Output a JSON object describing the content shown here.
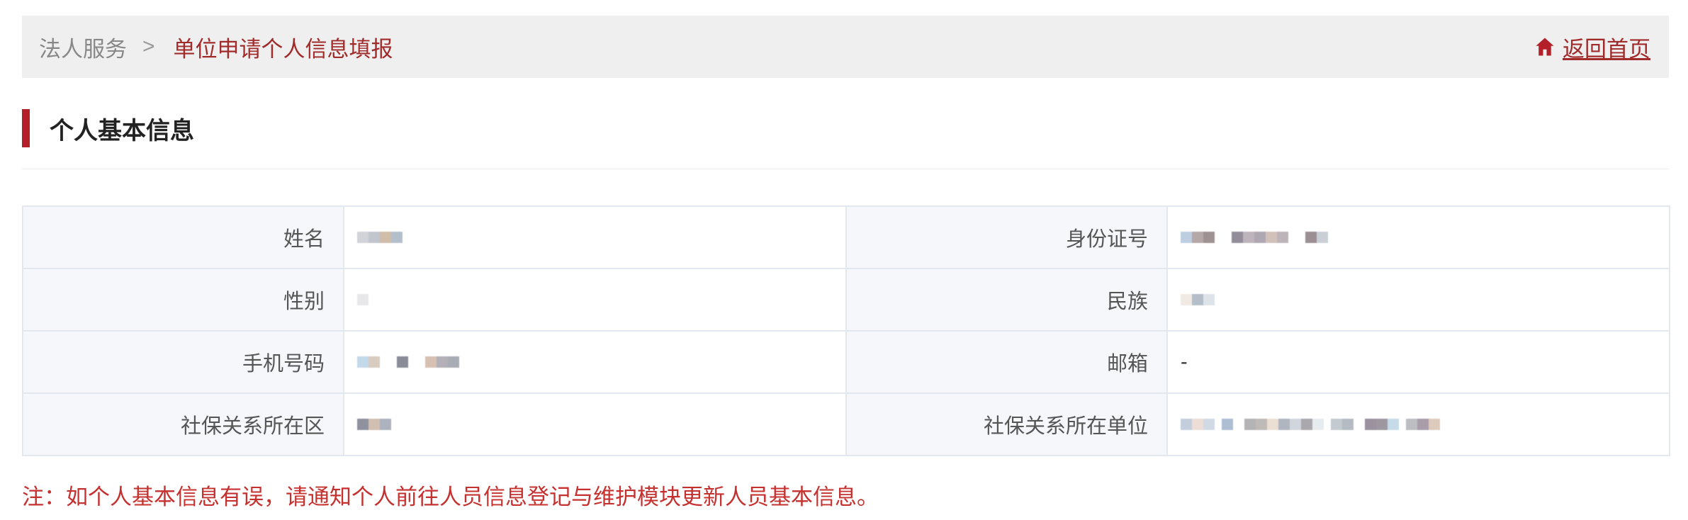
{
  "breadcrumb": {
    "parent": "法人服务",
    "separator": ">",
    "current": "单位申请个人信息填报",
    "home_label": "返回首页",
    "home_icon": "home-icon"
  },
  "section": {
    "title": "个人基本信息"
  },
  "rows": [
    {
      "left_label": "姓名",
      "left_value": "",
      "right_label": "身份证号",
      "right_value": ""
    },
    {
      "left_label": "性别",
      "left_value": "",
      "right_label": "民族",
      "right_value": ""
    },
    {
      "left_label": "手机号码",
      "left_value": "",
      "right_label": "邮箱",
      "right_value": "-"
    },
    {
      "left_label": "社保关系所在区",
      "left_value": "",
      "right_label": "社保关系所在单位",
      "right_value": ""
    }
  ],
  "note": "注：如个人基本信息有误，请通知个人前往人员信息登记与维护模块更新人员基本信息。",
  "colors": {
    "accent": "#b3202a",
    "breadcrumb_current": "#a12b2b",
    "note": "#c5312f"
  }
}
